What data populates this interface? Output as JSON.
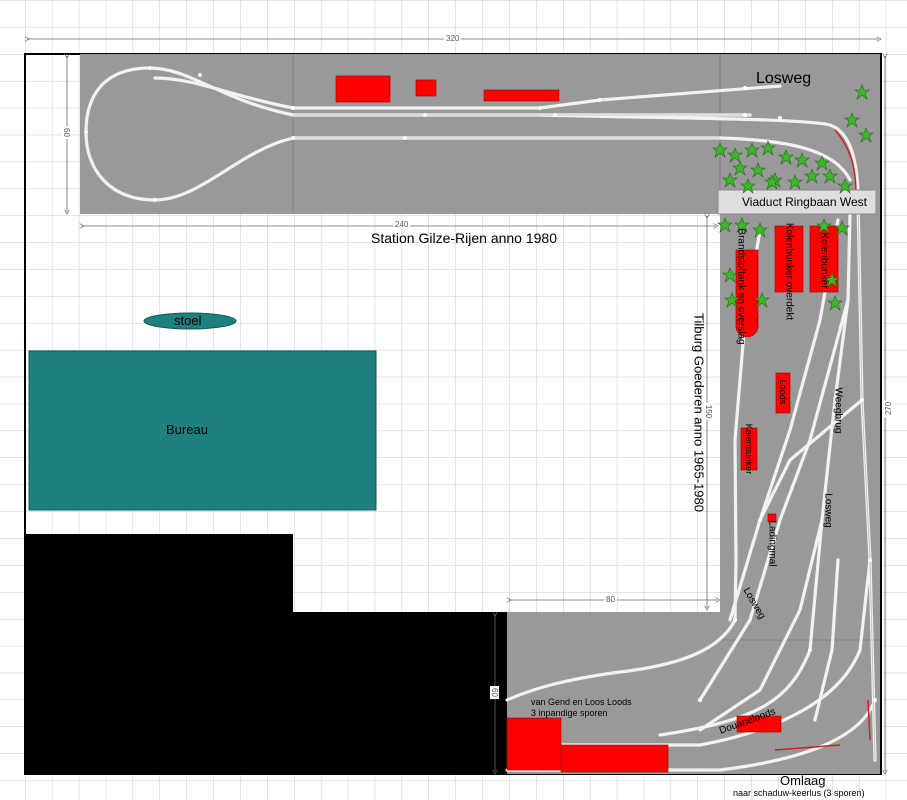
{
  "dimensions": {
    "overall_width": "320",
    "height_right": "270",
    "upper_depth": "60",
    "station_length": "240",
    "goods_length": "150",
    "corner_width": "80",
    "lower_depth": "60"
  },
  "labels": {
    "losweg_top": "Losweg",
    "viaduct": "Viaduct Ringbaan West",
    "station": "Station Gilze-Rijen anno 1980",
    "tilburg": "Tilburg Goederen anno 1965-1980",
    "stoel": "stoel",
    "bureau": "Bureau",
    "brandstof": "Brandstoftank en overslag",
    "kolenbunker_overdekt": "Kolenbunker overdekt",
    "kolenbunker_1": "Kolenbunker",
    "loods": "Loods",
    "kolenbunker_2": "Kolenbunker",
    "weegbrug": "Weegbrug",
    "losweg_mid": "Losweg",
    "lading": "Ladingmal",
    "losweg_low": "Losweg",
    "vangend_line1": "van Gend en Loos Loods",
    "vangend_line2": "3 inpandige sporen",
    "douaneloods": "Douaneloods",
    "omlaag": "Omlaag",
    "schaduw": "naar schaduw-keerlus (3 sporen)"
  },
  "colors": {
    "baseboard": "#999999",
    "building": "#ff0000",
    "furniture": "#1f8080",
    "obstacle": "#000000",
    "trees": "#33bb22",
    "grid": "#cccccc"
  }
}
